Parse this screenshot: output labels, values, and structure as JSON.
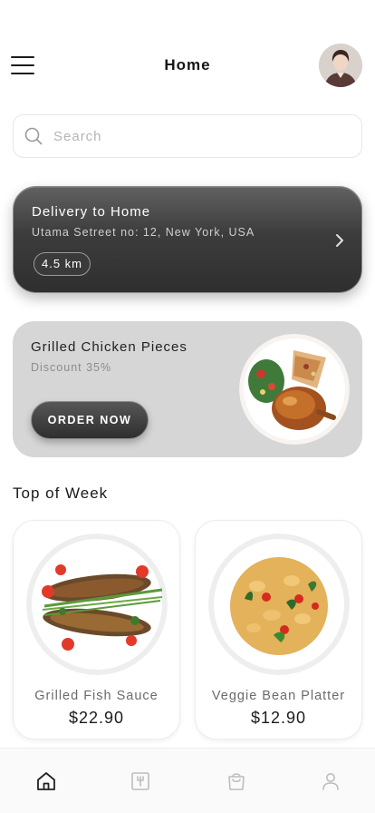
{
  "header": {
    "title": "Home",
    "menu_icon": "hamburger-icon",
    "avatar": "user-avatar"
  },
  "search": {
    "placeholder": "Search",
    "value": "",
    "icon": "search-icon"
  },
  "delivery": {
    "title": "Delivery to Home",
    "address": "Utama Setreet no: 12, New York, USA",
    "distance": "4.5 km",
    "icon": "chevron-right-icon"
  },
  "promo": {
    "title": "Grilled Chicken Pieces",
    "subtitle": "Discount 35%",
    "button_label": "ORDER NOW"
  },
  "top_of_week": {
    "title": "Top of Week",
    "items": [
      {
        "name": "Grilled Fish Sauce",
        "price": "$22.90"
      },
      {
        "name": "Veggie Bean Platter",
        "price": "$12.90"
      }
    ]
  },
  "tabbar": {
    "items": [
      {
        "icon": "home-icon",
        "active": true
      },
      {
        "icon": "menu-board-icon",
        "active": false
      },
      {
        "icon": "shopping-bag-icon",
        "active": false
      },
      {
        "icon": "user-icon",
        "active": false
      }
    ]
  },
  "colors": {
    "accent_dark": "#2f2f2f",
    "promo_bg": "#d6d6d6",
    "muted_text": "#8c8c8c",
    "tab_active": "#222222",
    "tab_inactive": "#bdbdbd"
  }
}
